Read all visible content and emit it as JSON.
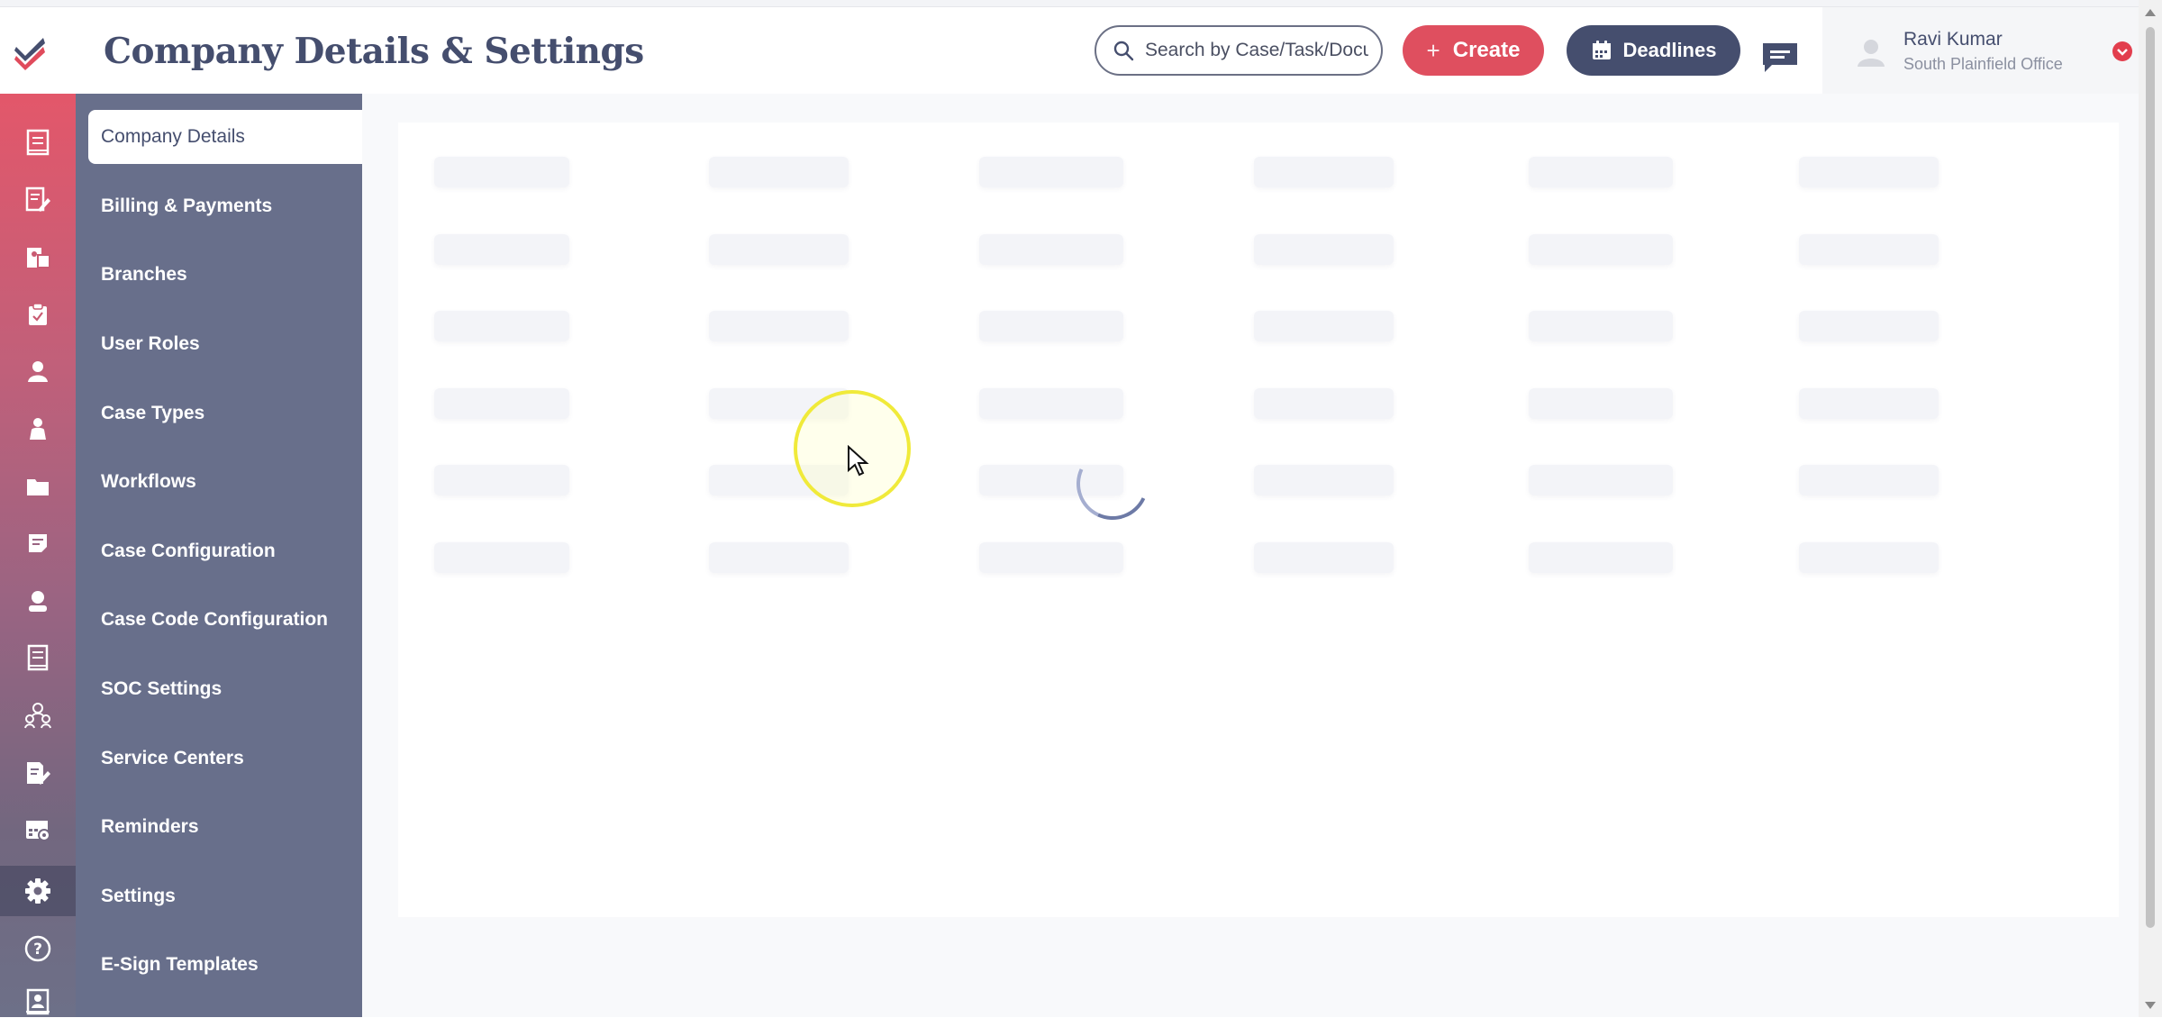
{
  "header": {
    "title": "Company Details & Settings",
    "search_placeholder": "Search by Case/Task/Document",
    "create_label": "Create",
    "deadlines_label": "Deadlines"
  },
  "user": {
    "name": "Ravi Kumar",
    "office": "South Plainfield Office"
  },
  "rail": {
    "icons": [
      "document-icon",
      "edit-document-icon",
      "case-folder-icon",
      "clipboard-icon",
      "client-icon",
      "person-icon",
      "folder-icon",
      "note-icon",
      "user-profile-icon",
      "book-icon",
      "team-icon",
      "file-edit-icon",
      "calendar-settings-icon",
      "gear-icon",
      "help-icon",
      "contacts-icon"
    ]
  },
  "settings_nav": {
    "items": [
      {
        "label": "Company Details",
        "active": true
      },
      {
        "label": "Billing & Payments"
      },
      {
        "label": "Branches"
      },
      {
        "label": "User Roles"
      },
      {
        "label": "Case Types"
      },
      {
        "label": "Workflows"
      },
      {
        "label": "Case Configuration"
      },
      {
        "label": "Case Code Configuration"
      },
      {
        "label": "SOC Settings"
      },
      {
        "label": "Service Centers"
      },
      {
        "label": "Reminders"
      },
      {
        "label": "Settings"
      },
      {
        "label": "E-Sign Templates"
      }
    ]
  },
  "content": {
    "state": "loading",
    "skeleton_rows": 6,
    "skeleton_columns": 6
  },
  "colors": {
    "brand_red": "#df4f5f",
    "navy": "#454e6e",
    "nav_bg": "#686f8b"
  }
}
